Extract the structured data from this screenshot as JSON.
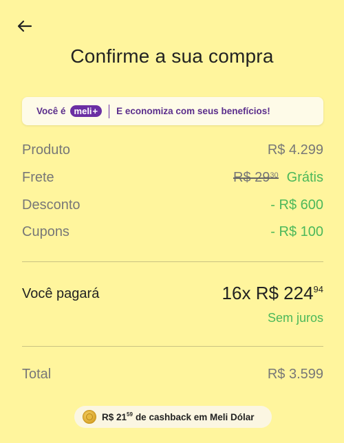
{
  "header": {
    "back_icon": "arrow-left-icon",
    "title": "Confirme a sua compra"
  },
  "banner": {
    "prefix": "Você é",
    "brand": "meli",
    "brand_plus": "+",
    "message": "E economiza com seus benefícios!"
  },
  "summary": {
    "product_label": "Produto",
    "product_value": "R$ 4.299",
    "shipping_label": "Frete",
    "shipping_old_whole": "R$ 29",
    "shipping_old_cents": "30",
    "shipping_value": "Grátis",
    "discount_label": "Desconto",
    "discount_value": "- R$ 600",
    "coupons_label": "Cupons",
    "coupons_value": "- R$ 100"
  },
  "payment": {
    "label": "Você pagará",
    "amount_whole": "16x R$ 224",
    "amount_cents": "94",
    "note": "Sem juros"
  },
  "total": {
    "label": "Total",
    "value": "R$ 3.599"
  },
  "cashback": {
    "icon": "coin-icon",
    "amount_whole": "R$ 21",
    "amount_cents": "59",
    "text": "de cashback em Meli Dólar"
  },
  "colors": {
    "background": "#fff59d",
    "green": "#4bb85a",
    "brand_purple": "#6b2fa3"
  }
}
